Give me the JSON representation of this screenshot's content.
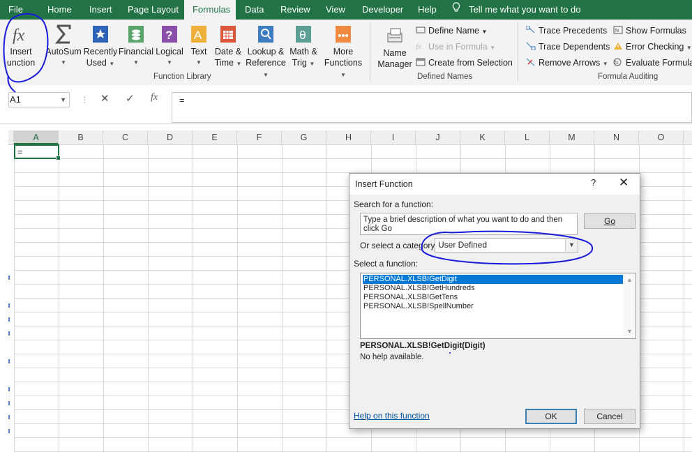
{
  "colors": {
    "accent": "#217346",
    "annotation": "#1a1adb",
    "selection": "#0078d7"
  },
  "tabs": [
    {
      "label": "File",
      "active": false
    },
    {
      "label": "Home",
      "active": false
    },
    {
      "label": "Insert",
      "active": false
    },
    {
      "label": "Page Layout",
      "active": false
    },
    {
      "label": "Formulas",
      "active": true
    },
    {
      "label": "Data",
      "active": false
    },
    {
      "label": "Review",
      "active": false
    },
    {
      "label": "View",
      "active": false
    },
    {
      "label": "Developer",
      "active": false
    },
    {
      "label": "Help",
      "active": false
    }
  ],
  "tell_me": "Tell me what you want to do",
  "ribbon": {
    "function_library": {
      "group_label": "Function Library",
      "insert_function": {
        "line1": "Insert",
        "line2": "unction"
      },
      "autosum": "AutoSum",
      "recently_used": {
        "line1": "Recently",
        "line2": "Used"
      },
      "financial": "Financial",
      "logical": "Logical",
      "text": "Text",
      "date_time": {
        "line1": "Date &",
        "line2": "Time"
      },
      "lookup_reference": {
        "line1": "Lookup &",
        "line2": "Reference"
      },
      "math_trig": {
        "line1": "Math &",
        "line2": "Trig"
      },
      "more_functions": {
        "line1": "More",
        "line2": "Functions"
      }
    },
    "defined_names": {
      "group_label": "Defined Names",
      "name_manager": {
        "line1": "Name",
        "line2": "Manager"
      },
      "define_name": "Define Name",
      "use_in_formula": "Use in Formula",
      "create_from_selection": "Create from Selection"
    },
    "formula_auditing": {
      "group_label": "Formula Auditing",
      "trace_precedents": "Trace Precedents",
      "trace_dependents": "Trace Dependents",
      "remove_arrows": "Remove Arrows",
      "show_formulas": "Show Formulas",
      "error_checking": "Error Checking",
      "evaluate_formula": "Evaluate Formula"
    }
  },
  "formula_bar": {
    "name_box": "A1",
    "content": "=",
    "fx": "fx"
  },
  "columns": [
    "A",
    "B",
    "C",
    "D",
    "E",
    "F",
    "G",
    "H",
    "I",
    "J",
    "K",
    "L",
    "M",
    "N",
    "O"
  ],
  "active_cell": {
    "value": "="
  },
  "dialog": {
    "title": "Insert Function",
    "help": "?",
    "search_label": "Search for a function:",
    "search_text": "Type a brief description of what you want to do and then click Go",
    "go": "Go",
    "category_label": "Or select a category:",
    "category_value": "User Defined",
    "select_label": "Select a function:",
    "functions": [
      "PERSONAL.XLSB!GetDigit",
      "PERSONAL.XLSB!GetHundreds",
      "PERSONAL.XLSB!GetTens",
      "PERSONAL.XLSB!SpellNumber"
    ],
    "selected_index": 0,
    "signature": "PERSONAL.XLSB!GetDigit(Digit)",
    "description": "No help available.",
    "help_link": "Help on this function",
    "ok": "OK",
    "cancel": "Cancel"
  }
}
